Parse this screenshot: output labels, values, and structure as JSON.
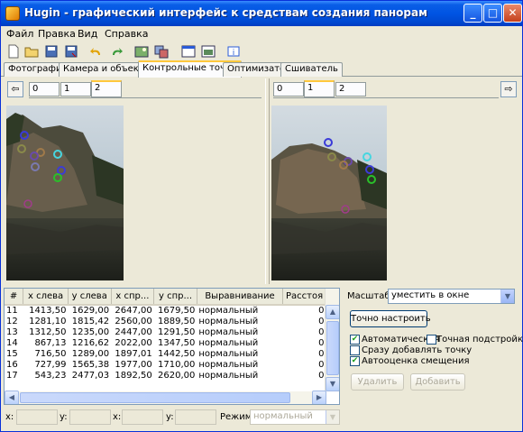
{
  "window": {
    "title": "Hugin - графический интерфейс к средствам создания панорам",
    "minimize": "_",
    "maximize": "□",
    "close": "✕"
  },
  "menu": [
    "Файл",
    "Правка",
    "Вид",
    "Справка"
  ],
  "tabs": [
    "Фотографии",
    "Камера и объектив",
    "Контрольные точки",
    "Оптимизатор",
    "Сшиватель"
  ],
  "left_pane": {
    "tabs": [
      "0",
      "1",
      "2"
    ],
    "active": "2",
    "arrow": "⇦"
  },
  "right_pane": {
    "tabs": [
      "0",
      "1",
      "2"
    ],
    "active": "1",
    "arrow": "⇨"
  },
  "table": {
    "columns": [
      "#",
      "x слева",
      "y слева",
      "x спр...",
      "y спр...",
      "Выравнивание",
      "Расстоя"
    ],
    "rows": [
      [
        "11",
        "1413,50",
        "1629,00",
        "2647,00",
        "1679,50",
        "нормальный",
        "0"
      ],
      [
        "12",
        "1281,10",
        "1815,42",
        "2560,00",
        "1889,50",
        "нормальный",
        "0"
      ],
      [
        "13",
        "1312,50",
        "1235,00",
        "2447,00",
        "1291,50",
        "нормальный",
        "0"
      ],
      [
        "14",
        "867,13",
        "1216,62",
        "2022,00",
        "1347,50",
        "нормальный",
        "0"
      ],
      [
        "15",
        "716,50",
        "1289,00",
        "1897,01",
        "1442,50",
        "нормальный",
        "0"
      ],
      [
        "16",
        "727,99",
        "1565,38",
        "1977,00",
        "1710,00",
        "нормальный",
        "0"
      ],
      [
        "17",
        "543,23",
        "2477,03",
        "1892,50",
        "2620,00",
        "нормальный",
        "0"
      ]
    ]
  },
  "controls": {
    "scale_label": "Масштаб:",
    "scale_value": "уместить в окне",
    "fine_tune_button": "Точно настроить",
    "auto_fine_tune": "Автоматическая",
    "auto_fine_tune_checked": true,
    "fine_tune_check": "Точная подстройка",
    "fine_tune_check_checked": false,
    "add_immediately": "Сразу добавлять точку",
    "add_immediately_checked": false,
    "auto_estimate": "Автооценка смещения",
    "auto_estimate_checked": true,
    "delete_button": "Удалить",
    "add_button": "Добавить"
  },
  "status": {
    "x1_label": "x:",
    "y1_label": "y:",
    "x2_label": "x:",
    "y2_label": "y:",
    "mode_label": "Режим:",
    "mode_value": "нормальный"
  },
  "colors": {
    "title_blue": "#0054e3",
    "tab_highlight": "#ffc83c",
    "checkbox_green": "#21a121"
  }
}
